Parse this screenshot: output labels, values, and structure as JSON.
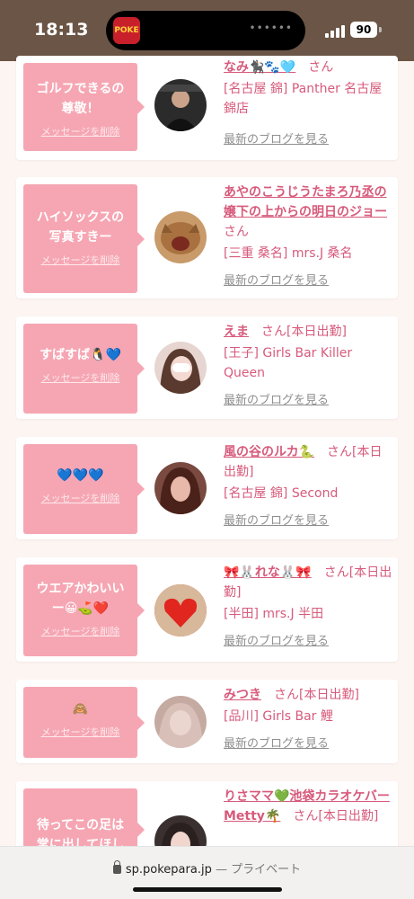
{
  "status_bar": {
    "time": "18:13",
    "battery": "90",
    "island_app": "POKE"
  },
  "delete_label": "メッセージを削除",
  "blog_label": "最新のブログを見る",
  "san": "さん",
  "cards": [
    {
      "message": "ゴルフできるの尊敬！",
      "name": "なみ🐈‍⬛🐾🩵",
      "suffix": "さん",
      "shop": "[名古屋 錦] Panther 名古屋錦店",
      "avatar_color": "#2b2b2b"
    },
    {
      "message": "ハイソックスの写真すきー",
      "name": "あやのこうじうたまろ乃丞の嬢下の上からの明日のジョー",
      "suffix": "さん",
      "shop": "[三重 桑名] mrs.J 桑名",
      "avatar_color": "#c99a6a"
    },
    {
      "message": "すばすば🐧💙",
      "name": "えま",
      "suffix": "さん[本日出勤]",
      "shop": "[王子] Girls Bar Killer Queen",
      "avatar_color": "#e6d5d0"
    },
    {
      "message": "💙💙💙",
      "name": "風の谷のルカ🐍",
      "suffix": "さん[本日出勤]",
      "shop": "[名古屋 錦] Second",
      "avatar_color": "#7a4a40"
    },
    {
      "message": "ウエアかわいいー😀⛳️❤️",
      "name": "🎀🐰れな🐰🎀",
      "suffix": "さん[本日出勤]",
      "shop": "[半田] mrs.J 半田",
      "avatar_color": "#c8403a"
    },
    {
      "message": "🙈",
      "name": "みつき",
      "suffix": "さん[本日出勤]",
      "shop": "[品川] Girls Bar 鯉",
      "avatar_color": "#c5aaa2"
    },
    {
      "message": "待ってこの足は常に出してほし",
      "name": "りさママ💚池袋カラオケバーMetty🌴",
      "suffix": "さん[本日出勤]",
      "shop": "",
      "avatar_color": "#3a3030"
    }
  ],
  "browser": {
    "url": "sp.pokepara.jp",
    "separator": "—",
    "mode": "プライベート"
  }
}
